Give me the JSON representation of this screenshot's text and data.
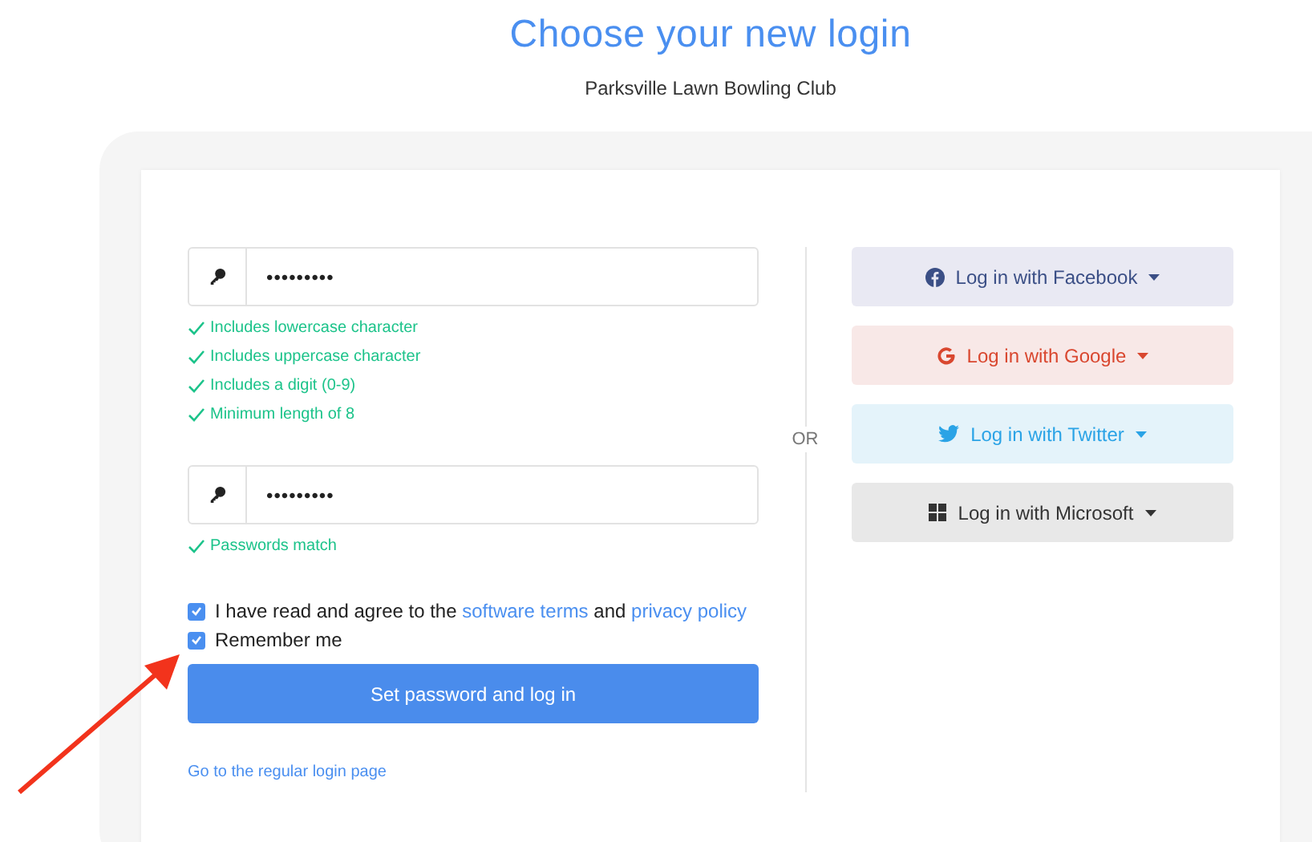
{
  "title": "Choose your new login",
  "subtitle": "Parksville Lawn Bowling Club",
  "password": {
    "value": "•••••••••"
  },
  "password_rules": [
    {
      "text": "Includes lowercase character",
      "met": true
    },
    {
      "text": "Includes uppercase character",
      "met": true
    },
    {
      "text": "Includes a digit (0-9)",
      "met": true
    },
    {
      "text": "Minimum length of 8",
      "met": true
    }
  ],
  "confirm_password": {
    "value": "•••••••••"
  },
  "confirm_rules": [
    {
      "text": "Passwords match",
      "met": true
    }
  ],
  "checkboxes": [
    {
      "checked": true,
      "parts": [
        {
          "text": "I have read and agree to the",
          "link": false
        },
        {
          "text": "software terms",
          "link": true
        },
        {
          "text": "and",
          "link": false
        },
        {
          "text": "privacy policy",
          "link": true
        }
      ]
    },
    {
      "checked": true,
      "parts": [
        {
          "text": "Remember me",
          "link": false
        }
      ]
    }
  ],
  "submit_button": "Set password and log in",
  "regular_login_link": "Go to the regular login page",
  "divider_text": "OR",
  "social_buttons": [
    {
      "kind": "facebook",
      "label": "Log in with Facebook"
    },
    {
      "kind": "google",
      "label": "Log in with Google"
    },
    {
      "kind": "twitter",
      "label": "Log in with Twitter"
    },
    {
      "kind": "microsoft",
      "label": "Log in with Microsoft"
    }
  ]
}
